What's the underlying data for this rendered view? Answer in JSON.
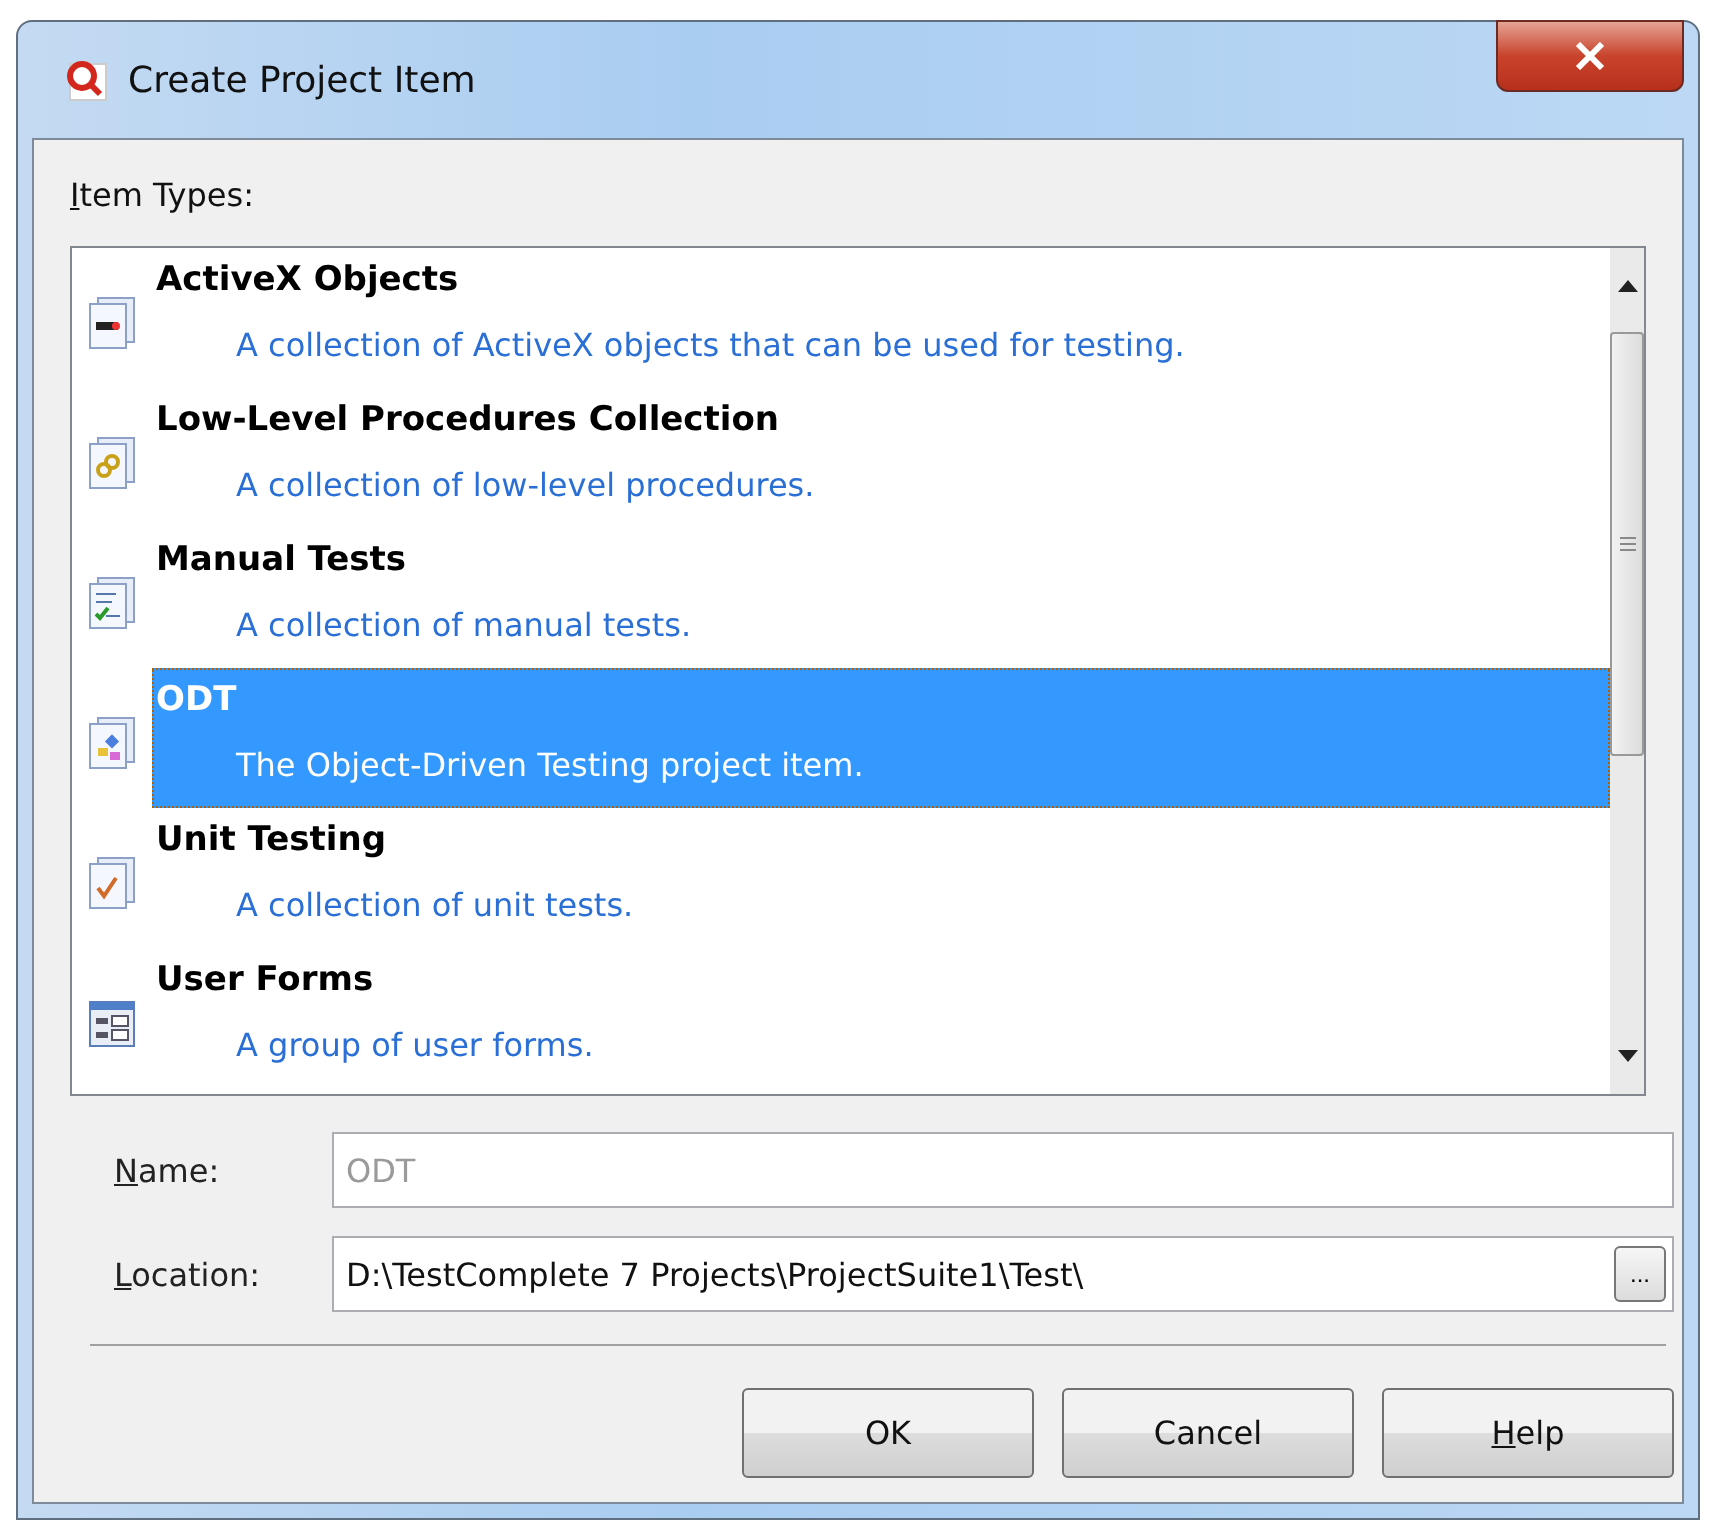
{
  "window": {
    "title": "Create Project Item"
  },
  "item_types": {
    "label": "Item Types:",
    "access_key_underlined": true,
    "items": [
      {
        "kind": "activex",
        "title": "ActiveX Objects",
        "description": "A collection of ActiveX objects that can be used for testing.",
        "selected": false
      },
      {
        "kind": "procedures",
        "title": "Low-Level Procedures Collection",
        "description": "A collection of low-level procedures.",
        "selected": false
      },
      {
        "kind": "manual",
        "title": "Manual Tests",
        "description": "A collection of manual tests.",
        "selected": false
      },
      {
        "kind": "odt",
        "title": "ODT",
        "description": "The Object-Driven Testing project item.",
        "selected": true
      },
      {
        "kind": "unit",
        "title": "Unit Testing",
        "description": "A collection of unit tests.",
        "selected": false
      },
      {
        "kind": "forms",
        "title": "User Forms",
        "description": "A group of user forms.",
        "selected": false
      }
    ]
  },
  "fields": [
    {
      "label": "Name:",
      "access_key_underlined": true,
      "value": "ODT",
      "disabled": true,
      "browse_button": false
    },
    {
      "label": "Location:",
      "access_key_underlined": true,
      "value": "D:\\TestComplete 7 Projects\\ProjectSuite1\\Test\\",
      "disabled": false,
      "browse_button": true,
      "browse_label": "..."
    }
  ],
  "buttons": [
    {
      "label": "OK",
      "access_key_underlined": false
    },
    {
      "label": "Cancel",
      "access_key_underlined": false
    },
    {
      "label": "Help",
      "access_key_underlined": true
    }
  ]
}
